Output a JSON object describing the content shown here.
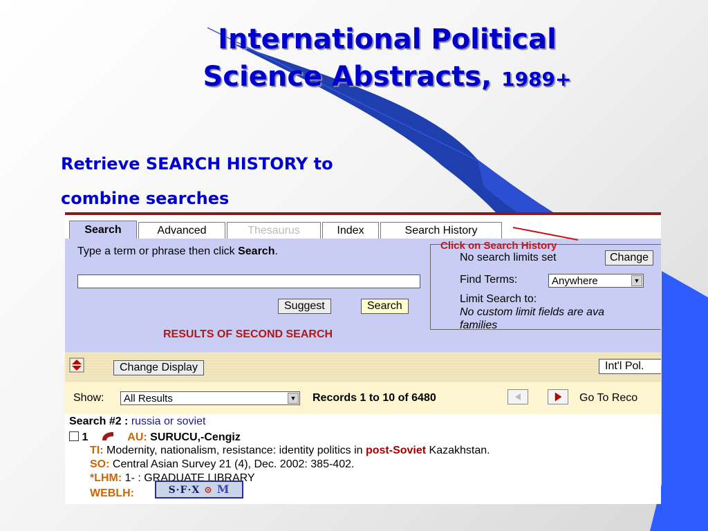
{
  "slide": {
    "title_line1": "International Political",
    "title_line2": "Science Abstracts,",
    "title_year": "1989+",
    "subtitle_line1": "Retrieve SEARCH HISTORY to",
    "subtitle_line2": "combine searches"
  },
  "tabs": [
    {
      "label": "Search",
      "state": "active"
    },
    {
      "label": "Advanced",
      "state": "normal"
    },
    {
      "label": "Thesaurus",
      "state": "disabled"
    },
    {
      "label": "Index",
      "state": "normal"
    },
    {
      "label": "Search History",
      "state": "normal"
    }
  ],
  "search_panel": {
    "hint_prefix": "Type a term or phrase then click ",
    "hint_bold": "Search",
    "hint_suffix": ".",
    "input_value": "",
    "suggest_label": "Suggest",
    "search_label": "Search",
    "results_note": "RESULTS OF SECOND SEARCH"
  },
  "annotation": "Click on Search History",
  "limits": {
    "no_limits_text": "No search limits set",
    "change_label": "Change",
    "find_terms_label": "Find Terms:",
    "find_terms_value": "Anywhere",
    "limit_search_label": "Limit Search to:",
    "no_custom_line1": "No custom limit fields are ava",
    "no_custom_line2": "families"
  },
  "toolbar": {
    "change_display_label": "Change Display",
    "database_label": "Int'l Pol."
  },
  "showbar": {
    "show_label": "Show:",
    "show_value": "All Results",
    "records_text": "Records 1 to 10 of 6480",
    "goto_text": "Go To Reco"
  },
  "record": {
    "search_label": "Search #2 : ",
    "search_query": "russia or soviet",
    "number": "1",
    "au_label": "AU:",
    "au_value": "SURUCU,-Cengiz",
    "ti_label": "TI:",
    "ti_before": "Modernity, nationalism, resistance: identity politics in ",
    "ti_highlight": "post-Soviet",
    "ti_after": " Kazakhstan.",
    "so_label": "SO:",
    "so_value": "Central Asian Survey 21 (4), Dec. 2002: 385-402.",
    "lhm_label": "*LHM:",
    "lhm_value": "1- : GRADUATE LIBRARY",
    "weblh_label": "WEBLH:",
    "sfx_text": "S·F·X",
    "sfx_o": "⊙",
    "sfx_m": "M"
  },
  "colors": {
    "title_blue": "#0000cc",
    "panel_lavender": "#c9cdf4",
    "annotation_red": "#c01818",
    "accent_blue": "#2f5cff"
  }
}
